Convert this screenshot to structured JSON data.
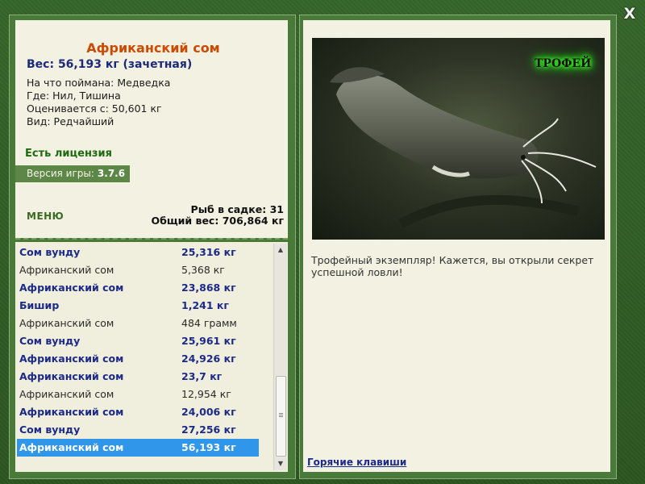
{
  "close_label": "X",
  "fish": {
    "title": "Африканский сом",
    "weight": "Вес: 56,193 кг (зачетная)",
    "caught_with": "На что поймана: Медведка",
    "location": "Где: Нил, Тишина",
    "rated_from": "Оценивается с: 50,601 кг",
    "kind": "Вид: Редчайший"
  },
  "license": "Есть лицензия",
  "version": {
    "label": "Версия игры:",
    "value": "3.7.6"
  },
  "menu_label": "МЕНЮ",
  "stats": {
    "fish_in_cage": "Рыб в садке: 31",
    "total_weight": "Общий вес: 706,864 кг"
  },
  "catch_list": [
    {
      "name": "Сом вунду",
      "weight": "25,316 кг",
      "style": "bold"
    },
    {
      "name": "Африканский сом",
      "weight": "5,368 кг",
      "style": "plain"
    },
    {
      "name": "Африканский сом",
      "weight": "23,868 кг",
      "style": "bold"
    },
    {
      "name": "Бишир",
      "weight": "1,241 кг",
      "style": "bold"
    },
    {
      "name": "Африканский сом",
      "weight": "484 грамм",
      "style": "plain"
    },
    {
      "name": "Сом вунду",
      "weight": "25,961 кг",
      "style": "bold"
    },
    {
      "name": "Африканский сом",
      "weight": "24,926 кг",
      "style": "bold"
    },
    {
      "name": "Африканский сом",
      "weight": "23,7 кг",
      "style": "bold"
    },
    {
      "name": "Африканский сом",
      "weight": "12,954 кг",
      "style": "plain"
    },
    {
      "name": "Африканский сом",
      "weight": "24,006 кг",
      "style": "bold"
    },
    {
      "name": "Сом вунду",
      "weight": "27,256 кг",
      "style": "bold"
    },
    {
      "name": "Африканский сом",
      "weight": "56,193 кг",
      "style": "selected"
    }
  ],
  "photo": {
    "badge": "ТРОФЕЙ"
  },
  "description": "Трофейный экземпляр! Кажется, вы открыли секрет успешной ловли!",
  "hotkeys_label": "Горячие клавиши"
}
